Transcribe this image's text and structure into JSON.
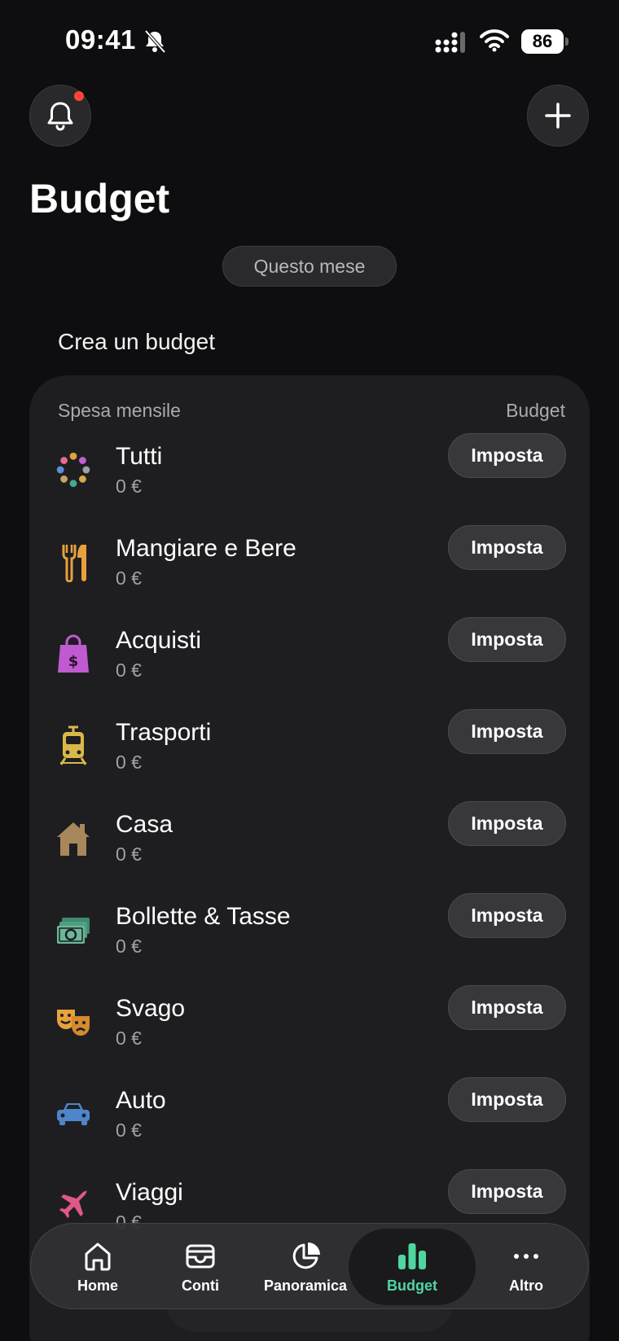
{
  "status_bar": {
    "time": "09:41",
    "battery": "86"
  },
  "header": {
    "title": "Budget",
    "period": "Questo mese"
  },
  "section": {
    "title": "Crea un budget"
  },
  "card": {
    "header_left": "Spesa mensile",
    "header_right": "Budget",
    "items": [
      {
        "name": "Tutti",
        "amount": "0 €",
        "button": "Imposta",
        "icon": "all-categories-icon"
      },
      {
        "name": "Mangiare e Bere",
        "amount": "0 €",
        "button": "Imposta",
        "icon": "fork-knife-icon"
      },
      {
        "name": "Acquisti",
        "amount": "0 €",
        "button": "Imposta",
        "icon": "shopping-bag-icon"
      },
      {
        "name": "Trasporti",
        "amount": "0 €",
        "button": "Imposta",
        "icon": "tram-icon"
      },
      {
        "name": "Casa",
        "amount": "0 €",
        "button": "Imposta",
        "icon": "house-icon"
      },
      {
        "name": "Bollette & Tasse",
        "amount": "0 €",
        "button": "Imposta",
        "icon": "banknotes-icon"
      },
      {
        "name": "Svago",
        "amount": "0 €",
        "button": "Imposta",
        "icon": "theater-masks-icon"
      },
      {
        "name": "Auto",
        "amount": "0 €",
        "button": "Imposta",
        "icon": "car-icon"
      },
      {
        "name": "Viaggi",
        "amount": "0 €",
        "button": "Imposta",
        "icon": "airplane-icon"
      }
    ]
  },
  "tab_bar": {
    "tabs": [
      {
        "label": "Home",
        "icon": "home-icon"
      },
      {
        "label": "Conti",
        "icon": "wallet-icon"
      },
      {
        "label": "Panoramica",
        "icon": "pie-chart-icon"
      },
      {
        "label": "Budget",
        "icon": "bar-chart-icon",
        "active": true
      },
      {
        "label": "Altro",
        "icon": "more-icon"
      }
    ]
  },
  "colors": {
    "accent": "#4fd6a0",
    "notification": "#ff453a",
    "background": "#0e0e10",
    "card": "#1e1e21"
  }
}
